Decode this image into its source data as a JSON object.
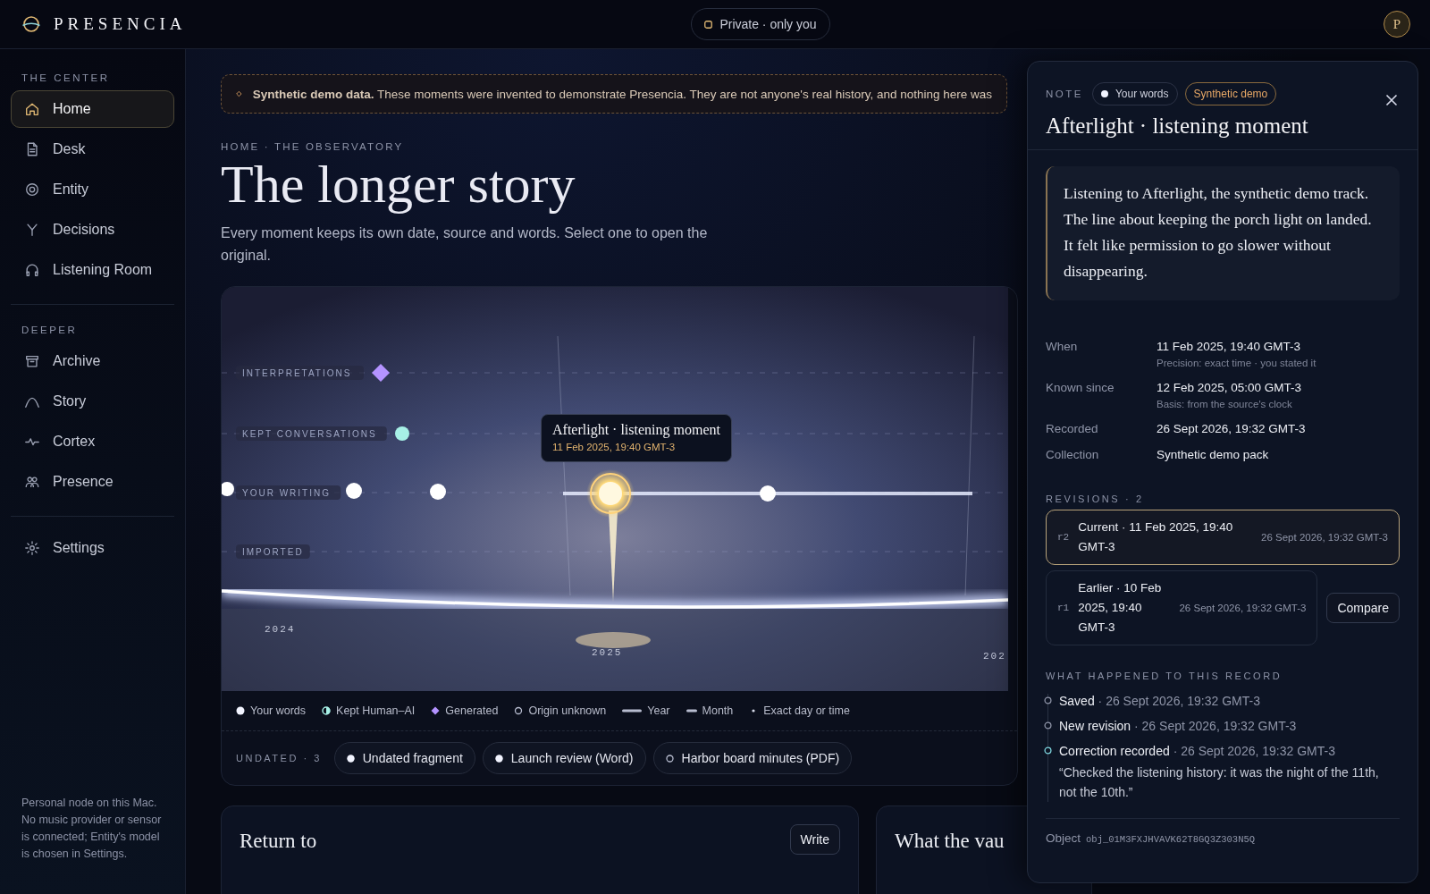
{
  "brand": {
    "name": "PRESENCIA"
  },
  "privacy": {
    "label": "Private · only you"
  },
  "avatar": {
    "initial": "P"
  },
  "sidebar": {
    "sections": [
      {
        "label": "THE CENTER",
        "items": [
          {
            "label": "Home",
            "selected": true
          },
          {
            "label": "Desk",
            "selected": false
          },
          {
            "label": "Entity",
            "selected": false
          },
          {
            "label": "Decisions",
            "selected": false
          },
          {
            "label": "Listening Room",
            "selected": false
          }
        ]
      },
      {
        "label": "DEEPER",
        "items": [
          {
            "label": "Archive",
            "selected": false
          },
          {
            "label": "Story",
            "selected": false
          },
          {
            "label": "Cortex",
            "selected": false
          },
          {
            "label": "Presence",
            "selected": false
          }
        ]
      },
      {
        "items": [
          {
            "label": "Settings",
            "selected": false
          }
        ]
      }
    ],
    "footnote": "Personal node on this Mac. No music provider or sensor is connected; Entity's model is chosen in Settings."
  },
  "banner": {
    "text": "**Synthetic demo data.** These moments were invented to demonstrate Presencia. They are not anyone's real history, and nothing here was"
  },
  "page": {
    "breadcrumb": "HOME · THE OBSERVATORY",
    "title": "The longer story",
    "intro": "Every moment keeps its own date, source and words. Select one to open the original."
  },
  "timeline": {
    "lanes": [
      "INTERPRETATIONS",
      "KEPT CONVERSATIONS",
      "YOUR WRITING",
      "IMPORTED"
    ],
    "years": [
      "2024",
      "2025",
      "202"
    ],
    "tooltip": {
      "title": "Afterlight · listening moment",
      "date": "11 Feb 2025, 19:40 GMT-3"
    }
  },
  "legend": [
    {
      "label": "Your words",
      "kind": "dot"
    },
    {
      "label": "Kept Human–AI",
      "kind": "half"
    },
    {
      "label": "Generated",
      "kind": "diamond"
    },
    {
      "label": "Origin unknown",
      "kind": "ring"
    },
    {
      "label": "Year",
      "kind": "bar"
    },
    {
      "label": "Month",
      "kind": "short"
    },
    {
      "label": "Exact day or time",
      "kind": "point"
    }
  ],
  "undated": {
    "label": "UNDATED · 3",
    "items": [
      {
        "label": "Undated fragment",
        "kind": "dot"
      },
      {
        "label": "Launch review (Word)",
        "kind": "dot"
      },
      {
        "label": "Harbor board minutes (PDF)",
        "kind": "ring"
      }
    ]
  },
  "cards": [
    {
      "title": "Return to",
      "button": "Write"
    },
    {
      "title": "What the vau"
    }
  ],
  "note": {
    "label": "NOTE",
    "chips": [
      {
        "label": "Your words",
        "kind": "source"
      },
      {
        "label": "Synthetic demo",
        "kind": "flag"
      }
    ],
    "title": "Afterlight · listening moment",
    "quote": "Listening to Afterlight, the synthetic demo track. The line about keeping the porch light on landed. It felt like permission to go slower without disappearing.",
    "facts": [
      {
        "label": "When",
        "value": "11 Feb 2025, 19:40 GMT-3",
        "detail": "Precision: exact time · you stated it"
      },
      {
        "label": "Known since",
        "value": "12 Feb 2025, 05:00 GMT-3",
        "detail": "Basis: from the source's clock"
      },
      {
        "label": "Recorded",
        "value": "26 Sept 2026, 19:32 GMT-3"
      },
      {
        "label": "Collection",
        "value": "Synthetic demo pack"
      }
    ],
    "revisions_label": "REVISIONS · 2",
    "revisions": [
      {
        "id": "r2",
        "title": "Current · 11 Feb 2025, 19:40 GMT-3",
        "time": "26 Sept 2026, 19:32 GMT-3",
        "selected": true
      },
      {
        "id": "r1",
        "title": "Earlier · 10 Feb 2025, 19:40 GMT-3",
        "time": "26 Sept 2026, 19:32 GMT-3",
        "selected": false,
        "action": "Compare"
      }
    ],
    "history_label": "WHAT HAPPENED TO THIS RECORD",
    "history": [
      {
        "event": "Saved",
        "time": "· 26 Sept 2026, 19:32 GMT-3",
        "active": false
      },
      {
        "event": "New revision",
        "time": "· 26 Sept 2026, 19:32 GMT-3",
        "active": false
      },
      {
        "event": "Correction recorded",
        "time": "· 26 Sept 2026, 19:32 GMT-3",
        "active": true,
        "comment": "“Checked the listening history: it was the night of the 11th, not the 10th.”"
      }
    ],
    "object_label": "Object",
    "object_id": "obj_01M3FXJHVAVK62T8GQ3Z303N5Q"
  }
}
